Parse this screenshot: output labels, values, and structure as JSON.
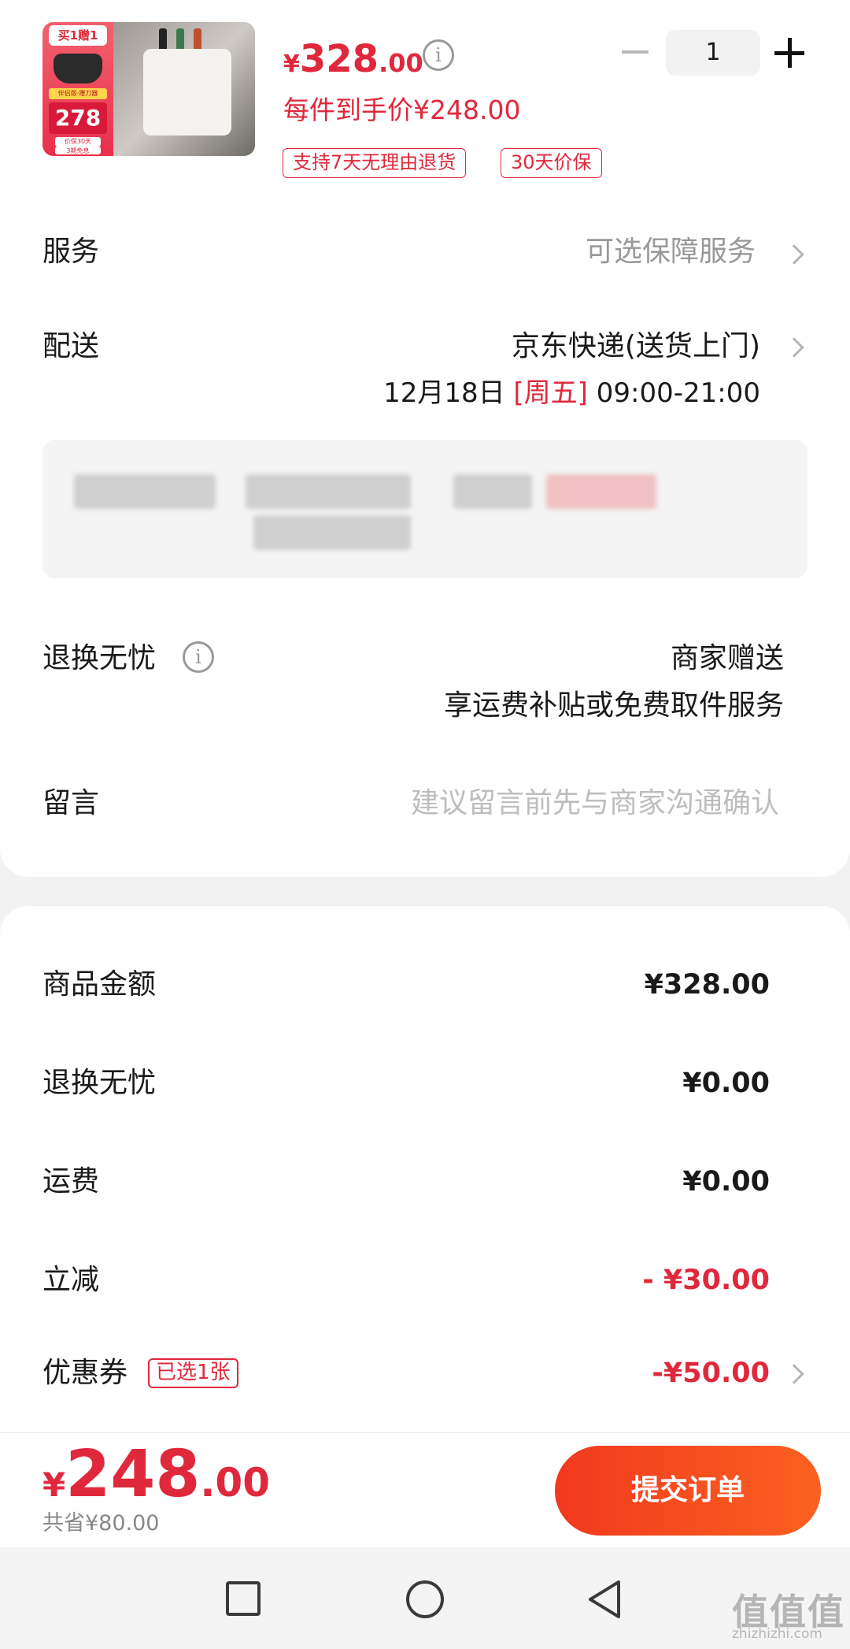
{
  "product": {
    "promo_tag": "买1赠1",
    "promo_mini": "伴侣版·赠刀器",
    "promo_big": "278",
    "promo_sub1": "价保30天",
    "promo_sub2": "3期免息",
    "price_yen": "¥",
    "price_int": "328",
    "price_dec": ".00",
    "unit_price": "每件到手价¥248.00",
    "badges": [
      "支持7天无理由退货",
      "30天价保"
    ],
    "quantity": "1"
  },
  "service": {
    "label": "服务",
    "value": "可选保障服务"
  },
  "delivery": {
    "label": "配送",
    "method": "京东快递(送货上门)",
    "date": "12月18日",
    "weekday": "[周五]",
    "time": "09:00-21:00"
  },
  "return_worry": {
    "label": "退换无忧",
    "value_line1": "商家赠送",
    "value_line2": "享运费补贴或免费取件服务"
  },
  "message": {
    "label": "留言",
    "placeholder": "建议留言前先与商家沟通确认"
  },
  "summary": {
    "rows": [
      {
        "label": "商品金额",
        "value": "¥328.00"
      },
      {
        "label": "退换无忧",
        "value": "¥0.00"
      },
      {
        "label": "运费",
        "value": "¥0.00"
      },
      {
        "label": "立减",
        "value": "- ¥30.00"
      },
      {
        "label": "优惠券",
        "value": "-¥50.00"
      }
    ],
    "coupon_tag": "已选1张"
  },
  "footer": {
    "total_yen": "¥",
    "total_int": "248",
    "total_dec": ".00",
    "saved": "共省¥80.00",
    "submit_label": "提交订单"
  },
  "watermark": {
    "main": "值值值",
    "sub": "zhizhizhi.com"
  },
  "colors": {
    "accent": "#e0283c",
    "button_start": "#f1391f",
    "button_end": "#fb6120"
  }
}
